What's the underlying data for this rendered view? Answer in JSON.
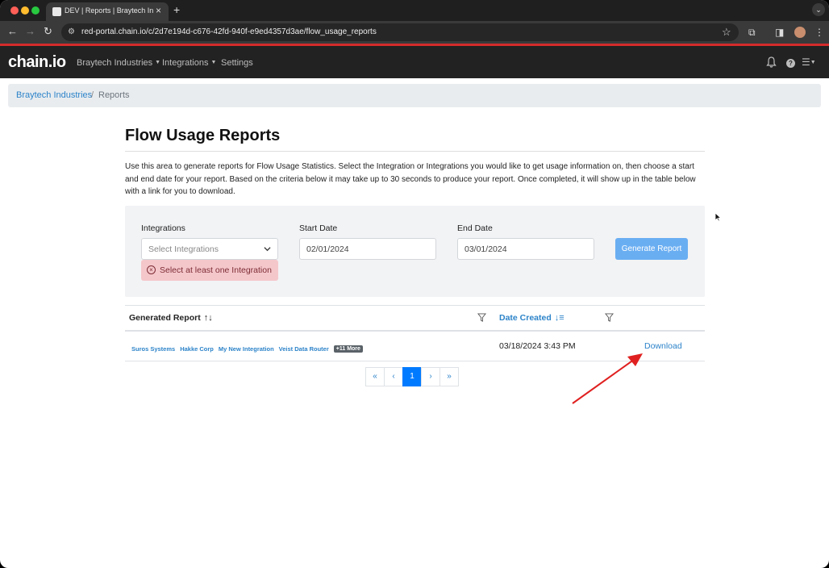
{
  "browser": {
    "tab_title": "DEV | Reports | Braytech Industries",
    "new_tab": "+",
    "close": "×",
    "url": "red-portal.chain.io/c/2d7e194d-c676-42fd-940f-e9ed4357d3ae/flow_usage_reports"
  },
  "nav": {
    "logo": "chain.io",
    "items": [
      "Braytech Industries",
      "Integrations",
      "Settings"
    ]
  },
  "breadcrumb": {
    "items": [
      "Braytech Industries",
      "Reports"
    ],
    "separator": "/"
  },
  "page": {
    "title": "Flow Usage Reports",
    "description": "Use this area to generate reports for Flow Usage Statistics. Select the Integration or Integrations you would like to get usage information on, then choose a start and end date for your report. Based on the criteria below it may take up to 30 seconds to produce your report. Once completed, it will show up in the table below with a link for you to download."
  },
  "form": {
    "integrations_label": "Integrations",
    "integrations_placeholder": "Select Integrations",
    "start_label": "Start Date",
    "start_value": "02/01/2024",
    "end_label": "End Date",
    "end_value": "03/01/2024",
    "error": "Select at least one Integration",
    "generate_button": "Generate Report"
  },
  "table": {
    "headers": [
      "Generated Report",
      "Date Created"
    ],
    "rows": [
      {
        "integrations": [
          "Suros Systems",
          "Hakke Corp",
          "My New Integration",
          "Veist Data Router"
        ],
        "more": "+11 More",
        "date_created": "03/18/2024 3:43 PM",
        "action": "Download"
      }
    ]
  },
  "pagination": {
    "first": "«",
    "prev": "‹",
    "current": "1",
    "next": "›",
    "last": "»"
  },
  "colors": {
    "accent": "#2c83c9",
    "nav_bg": "#222222",
    "brand_red": "#d42b2b",
    "error_bg": "#f4c7cb",
    "button_bg": "#6aaef2",
    "annotation_arrow": "#e02020"
  }
}
